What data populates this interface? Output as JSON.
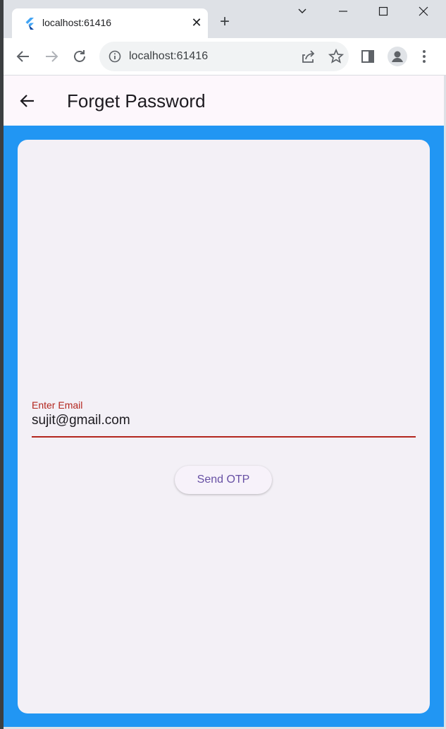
{
  "browser": {
    "tab_title": "localhost:61416",
    "tab_close_glyph": "✕",
    "new_tab_glyph": "+",
    "url": "localhost:61416",
    "icons": [
      "flutter-favicon",
      "close-icon",
      "plus-icon",
      "chevron-down-icon",
      "minimize-icon",
      "maximize-icon",
      "window-close-icon",
      "back-icon",
      "forward-icon",
      "reload-icon",
      "info-icon",
      "share-icon",
      "star-icon",
      "sidepanel-icon",
      "profile-icon",
      "kebab-menu-icon"
    ]
  },
  "app": {
    "title": "Forget Password",
    "email_label": "Enter Email",
    "email_value": "sujit@gmail.com",
    "send_button": "Send OTP"
  },
  "colors": {
    "primary_blue": "#2196f3",
    "error_red": "#b3261e",
    "button_text": "#6750a4",
    "card_bg": "#f3f0f6"
  }
}
